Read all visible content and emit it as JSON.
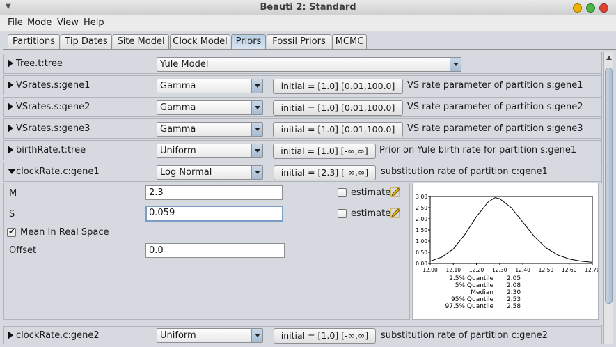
{
  "window": {
    "title": "Beauti 2: Standard"
  },
  "menu": [
    "File",
    "Mode",
    "View",
    "Help"
  ],
  "tabs": [
    "Partitions",
    "Tip Dates",
    "Site Model",
    "Clock Model",
    "Priors",
    "Fossil Priors",
    "MCMC"
  ],
  "active_tab": "Priors",
  "priors": [
    {
      "name": "Tree.t:tree",
      "distribution": "Yule Model",
      "initial": "",
      "description": ""
    },
    {
      "name": "VSrates.s:gene1",
      "distribution": "Gamma",
      "initial": "initial = [1.0] [0.01,100.0]",
      "description": "VS rate parameter of partition s:gene1"
    },
    {
      "name": "VSrates.s:gene2",
      "distribution": "Gamma",
      "initial": "initial = [1.0] [0.01,100.0]",
      "description": "VS rate parameter of partition s:gene2"
    },
    {
      "name": "VSrates.s:gene3",
      "distribution": "Gamma",
      "initial": "initial = [1.0] [0.01,100.0]",
      "description": "VS rate parameter of partition s:gene3"
    },
    {
      "name": "birthRate.t:tree",
      "distribution": "Uniform",
      "initial": "initial = [1.0] [-∞,∞]",
      "description": "Prior on Yule birth rate for partition s:gene1"
    },
    {
      "name": "clockRate.c:gene1",
      "distribution": "Log Normal",
      "initial": "initial = [2.3] [-∞,∞]",
      "description": "substitution rate of partition c:gene1"
    },
    {
      "name": "clockRate.c:gene2",
      "distribution": "Uniform",
      "initial": "initial = [1.0] [-∞,∞]",
      "description": "substitution rate of partition c:gene2"
    }
  ],
  "expanded": {
    "M_label": "M",
    "M_value": "2.3",
    "S_label": "S",
    "S_value": "0.059",
    "estimate_label": "estimate",
    "mean_real_label": "Mean In Real Space",
    "mean_real_checked": true,
    "offset_label": "Offset",
    "offset_value": "0.0"
  },
  "quantiles": [
    {
      "label": "2.5% Quantile",
      "value": "2.05"
    },
    {
      "label": "5% Quantile",
      "value": "2.08"
    },
    {
      "label": "Median",
      "value": "2.30"
    },
    {
      "label": "95% Quantile",
      "value": "2.53"
    },
    {
      "label": "97.5% Quantile",
      "value": "2.58"
    }
  ],
  "chart_data": {
    "type": "line",
    "x_ticks": [
      "12.00",
      "12.10",
      "12.20",
      "12.30",
      "12.40",
      "12.50",
      "12.60",
      "12.70"
    ],
    "y_ticks": [
      "0.00",
      "0.50",
      "1.00",
      "1.50",
      "2.00",
      "2.50",
      "3.00"
    ],
    "xlim": [
      12.0,
      12.7
    ],
    "ylim": [
      0,
      3.0
    ],
    "series": [
      {
        "x": [
          12.0,
          12.05,
          12.1,
          12.15,
          12.2,
          12.25,
          12.28,
          12.3,
          12.35,
          12.4,
          12.45,
          12.5,
          12.55,
          12.6,
          12.65,
          12.7
        ],
        "y": [
          0.1,
          0.28,
          0.65,
          1.3,
          2.1,
          2.75,
          2.95,
          2.9,
          2.5,
          1.85,
          1.2,
          0.7,
          0.38,
          0.2,
          0.1,
          0.05
        ]
      }
    ]
  },
  "colors": {
    "accent": "#b8cfe5",
    "panel": "#d6d9df",
    "close": "#e0442f",
    "min": "#f0b400",
    "max": "#48b847"
  },
  "icons": [
    "window-menu-icon",
    "pencil-icon",
    "collapse-triangle-icon",
    "expand-triangle-icon"
  ]
}
